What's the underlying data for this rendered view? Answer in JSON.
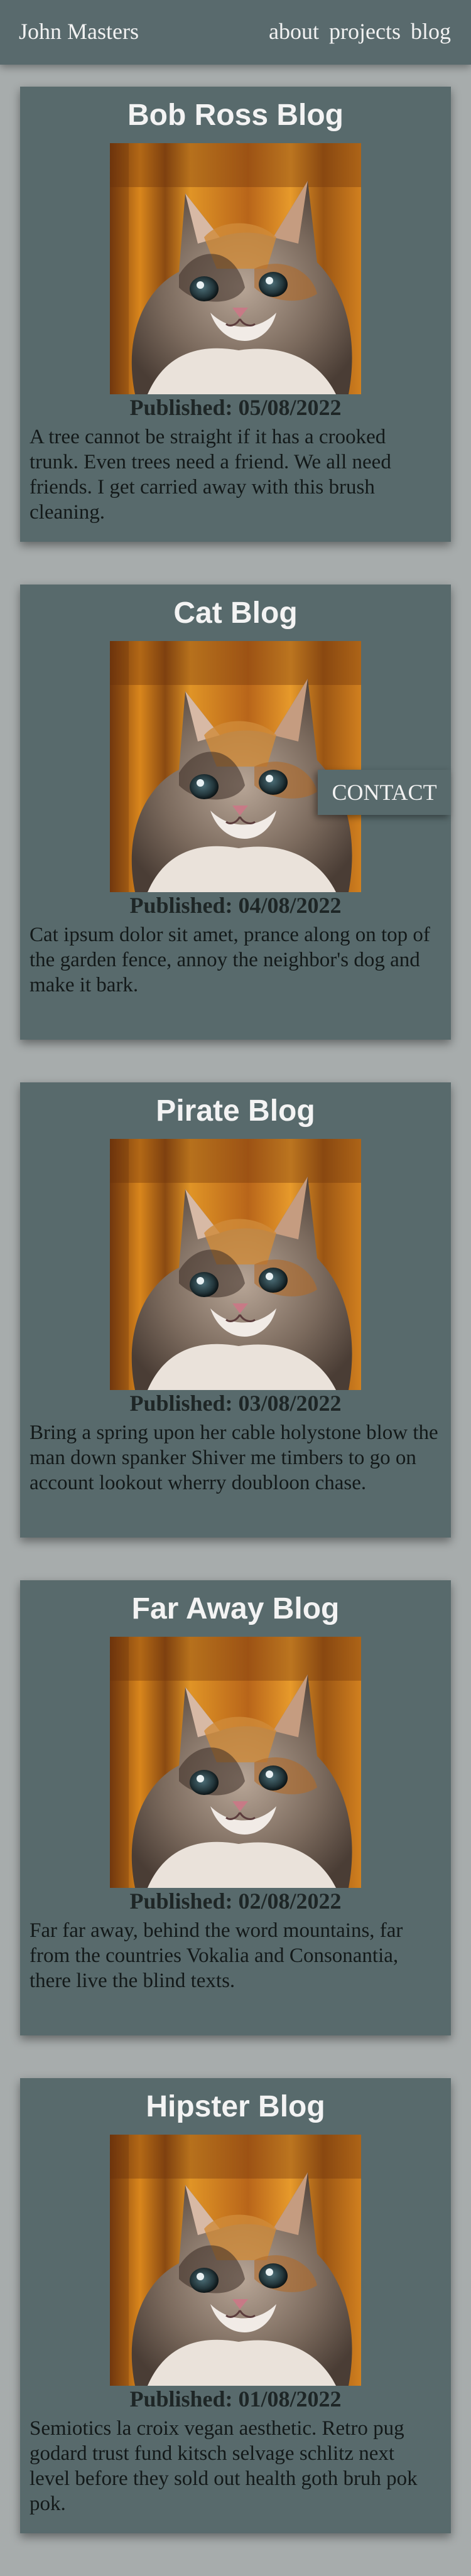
{
  "header": {
    "brand": "John Masters",
    "nav": [
      "about",
      "projects",
      "blog"
    ]
  },
  "posts": [
    {
      "title": "Bob Ross Blog",
      "published_label": "Published:",
      "date": "05/08/2022",
      "excerpt": "A tree cannot be straight if it has a crooked trunk. Even trees need a friend. We all need friends. I get carried away with this brush cleaning."
    },
    {
      "title": "Cat Blog",
      "published_label": "Published:",
      "date": "04/08/2022",
      "excerpt": "Cat ipsum dolor sit amet, prance along on top of the garden fence, annoy the neighbor's dog and make it bark."
    },
    {
      "title": "Pirate Blog",
      "published_label": "Published:",
      "date": "03/08/2022",
      "excerpt": "Bring a spring upon her cable holystone blow the man down spanker Shiver me timbers to go on account lookout wherry doubloon chase."
    },
    {
      "title": "Far Away Blog",
      "published_label": "Published:",
      "date": "02/08/2022",
      "excerpt": "Far far away, behind the word mountains, far from the countries Vokalia and Consonantia, there live the blind texts."
    },
    {
      "title": "Hipster Blog",
      "published_label": "Published:",
      "date": "01/08/2022",
      "excerpt": "Semiotics la croix vegan aesthetic. Retro pug godard trust fund kitsch selvage schlitz next level before they sold out health goth bruh pok pok."
    }
  ],
  "contact_button": "CONTACT",
  "colors": {
    "page_background": "#a7acac",
    "card_background": "#586a6c",
    "navbar_background": "#596a6d",
    "title_text": "#f3f3f3",
    "body_text": "#131919"
  }
}
